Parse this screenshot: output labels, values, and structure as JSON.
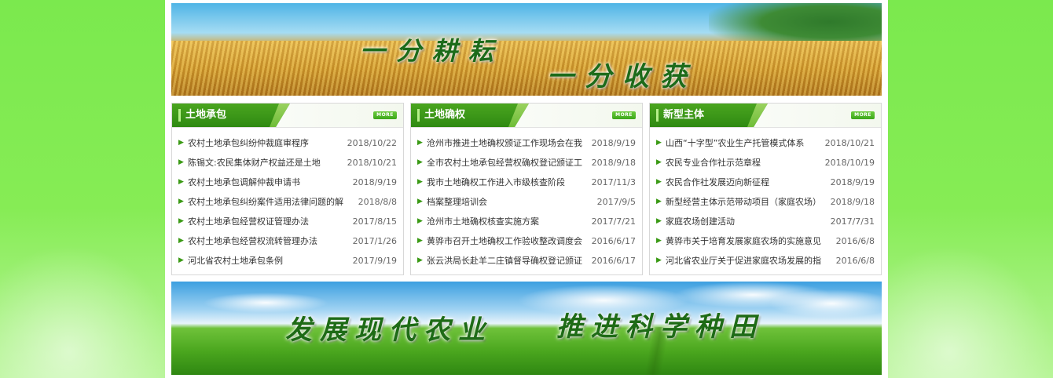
{
  "banner_top": {
    "slogan_left": "一分耕耘",
    "slogan_right": "一分收获"
  },
  "panels": [
    {
      "title": "土地承包",
      "more": "MORE",
      "items": [
        {
          "title": "农村土地承包纠纷仲裁庭审程序",
          "date": "2018/10/22"
        },
        {
          "title": "陈锡文:农民集体财产权益还是土地",
          "date": "2018/10/21"
        },
        {
          "title": "农村土地承包调解仲裁申请书",
          "date": "2018/9/19"
        },
        {
          "title": "农村土地承包纠纷案件适用法律问题的解",
          "date": "2018/8/8"
        },
        {
          "title": "农村土地承包经营权证管理办法",
          "date": "2017/8/15"
        },
        {
          "title": "农村土地承包经营权流转管理办法",
          "date": "2017/1/26"
        },
        {
          "title": "河北省农村土地承包条例",
          "date": "2017/9/19"
        }
      ]
    },
    {
      "title": "土地确权",
      "more": "MORE",
      "items": [
        {
          "title": "沧州市推进土地确权颁证工作现场会在我",
          "date": "2018/9/19"
        },
        {
          "title": "全市农村土地承包经营权确权登记颁证工",
          "date": "2018/9/18"
        },
        {
          "title": "我市土地确权工作进入市级核查阶段",
          "date": "2017/11/3"
        },
        {
          "title": "档案整理培训会",
          "date": "2017/9/5"
        },
        {
          "title": "沧州市土地确权核查实施方案",
          "date": "2017/7/21"
        },
        {
          "title": "黄骅市召开土地确权工作验收整改调度会",
          "date": "2016/6/17"
        },
        {
          "title": "张云洪局长赴羊二庄镇督导确权登记颁证",
          "date": "2016/6/17"
        }
      ]
    },
    {
      "title": "新型主体",
      "more": "MORE",
      "items": [
        {
          "title": "山西“十字型”农业生产托管模式体系",
          "date": "2018/10/21"
        },
        {
          "title": "农民专业合作社示范章程",
          "date": "2018/10/19"
        },
        {
          "title": "农民合作社发展迈向新征程",
          "date": "2018/9/19"
        },
        {
          "title": "新型经营主体示范带动项目（家庭农场）",
          "date": "2018/9/18"
        },
        {
          "title": "家庭农场创建活动",
          "date": "2017/7/31"
        },
        {
          "title": "黄骅市关于培育发展家庭农场的实施意见",
          "date": "2016/6/8"
        },
        {
          "title": "河北省农业厅关于促进家庭农场发展的指",
          "date": "2016/6/8"
        }
      ]
    }
  ],
  "banner_bottom": {
    "slogan_left": "发展现代农业",
    "slogan_right": "推进科学种田"
  }
}
